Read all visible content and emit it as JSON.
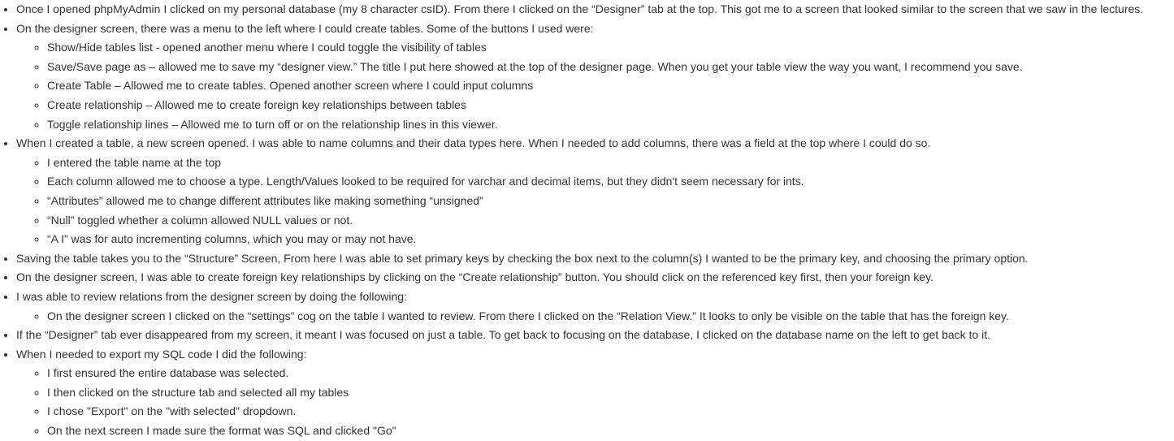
{
  "items": [
    {
      "text": "Once I opened phpMyAdmin I clicked on my personal database (my 8 character csID). From there I clicked on the “Designer” tab at the top. This got me to a screen that looked similar to the screen that we saw in the lectures.",
      "sub": []
    },
    {
      "text": "On the designer screen, there was a menu to the left where I could create tables. Some of the buttons I used were:",
      "sub": [
        "Show/Hide tables list - opened another menu where I could toggle the visibility of tables",
        "Save/Save page as – allowed me to save my “designer view.” The title I put here showed at the top of the designer page. When you get your table view the way you want, I recommend you save.",
        "Create Table – Allowed me to create tables. Opened another screen where I could input columns",
        "Create relationship – Allowed me to create foreign key relationships between tables",
        "Toggle relationship lines – Allowed me to turn off or on the relationship lines in this viewer."
      ]
    },
    {
      "text": "When I created a table, a new screen opened. I was able to name columns and their data types here. When I needed to add columns, there was a field at the top where I could do so.",
      "sub": [
        "I entered the table name at the top",
        "Each column allowed me to choose a type. Length/Values looked to be required for varchar and decimal items, but they didn't seem necessary for ints.",
        "“Attributes” allowed me to change different attributes like making something “unsigned”",
        "“Null” toggled whether a column allowed NULL values or not.",
        "“A I”  was for auto incrementing columns, which you may or may not have."
      ]
    },
    {
      "text": "Saving the table takes you to the “Structure” Screen, From here I was able to set primary keys by checking the box next to the column(s) I wanted to be the primary key, and choosing the primary option.",
      "sub": []
    },
    {
      "text": "On the designer screen, I was able to create foreign key relationships by clicking on the “Create relationship” button. You should click on the referenced key first, then your foreign key.",
      "sub": []
    },
    {
      "text": "I was able to review relations from the designer screen by doing the following:",
      "sub": [
        "On the designer screen I clicked on the “settings” cog on the table I wanted to review. From there I clicked on the “Relation View.” It looks to only be visible on the table that has the foreign key."
      ]
    },
    {
      "text": "If the “Designer” tab ever disappeared from my screen, it meant I was focused on just a table. To get back to focusing on the database, I clicked on the database name on the left to get back to it.",
      "sub": []
    },
    {
      "text": "When I needed to export my SQL code I did the following:",
      "sub": [
        "I first ensured the entire database was selected.",
        "I then clicked on the structure tab and selected all my tables",
        "I chose \"Export\" on the \"with selected\" dropdown.",
        "On the next screen I made sure the format was SQL and clicked \"Go\""
      ]
    }
  ]
}
